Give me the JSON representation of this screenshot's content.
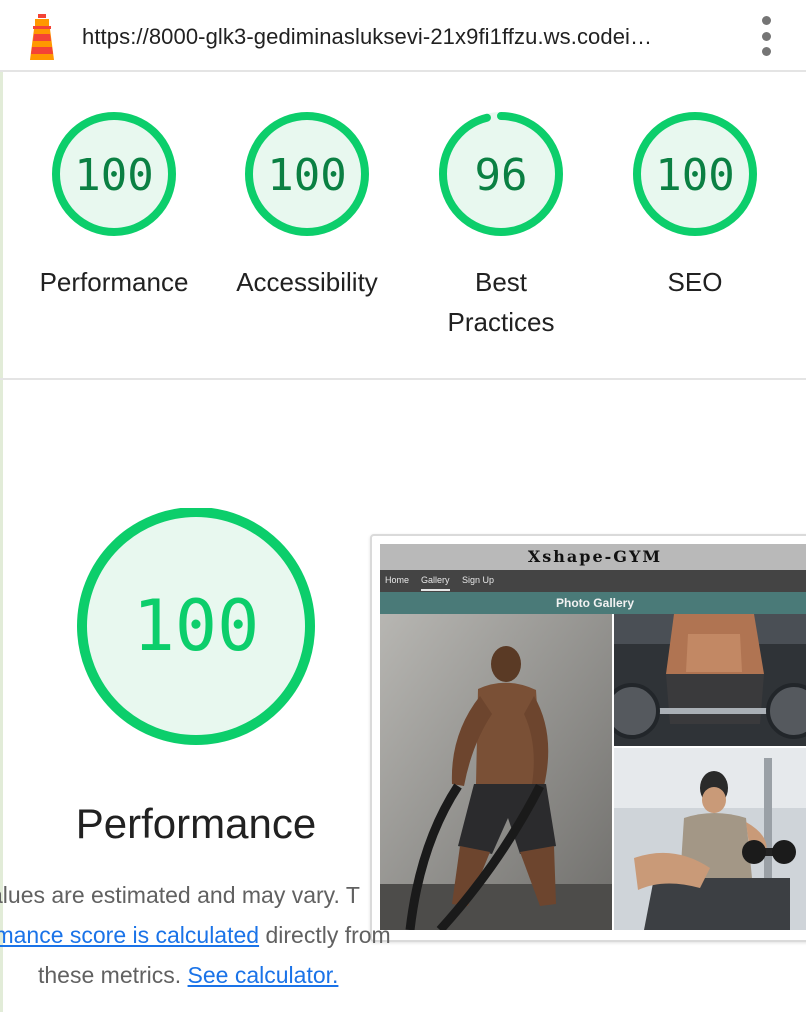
{
  "toolbar": {
    "url": "https://8000-glk3-gediminasluksevi-21x9fi1ffzu.ws.codei…"
  },
  "categories": [
    {
      "score": "100",
      "label": "Performance",
      "ratio": 1.0
    },
    {
      "score": "100",
      "label": "Accessibility",
      "ratio": 1.0
    },
    {
      "score": "96",
      "label": "Best Practices",
      "ratio": 0.96
    },
    {
      "score": "100",
      "label": "SEO",
      "ratio": 1.0
    }
  ],
  "performance": {
    "score": "100",
    "title": "Performance",
    "note_line1": "alues are estimated and may vary. T",
    "note_link1": "ormance score is calculated",
    "note_line2_rest": " directly from",
    "note_line3": "these metrics. ",
    "note_link2": "See calculator."
  },
  "screenshot": {
    "site_title": "Xshape-GYM",
    "nav": [
      "Home",
      "Gallery",
      "Sign Up"
    ],
    "section_title": "Photo Gallery"
  },
  "colors": {
    "pass": "#0cce6b",
    "pass_text": "#0b8043",
    "pass_fill": "#e8f8ef",
    "link": "#1a73e8"
  }
}
